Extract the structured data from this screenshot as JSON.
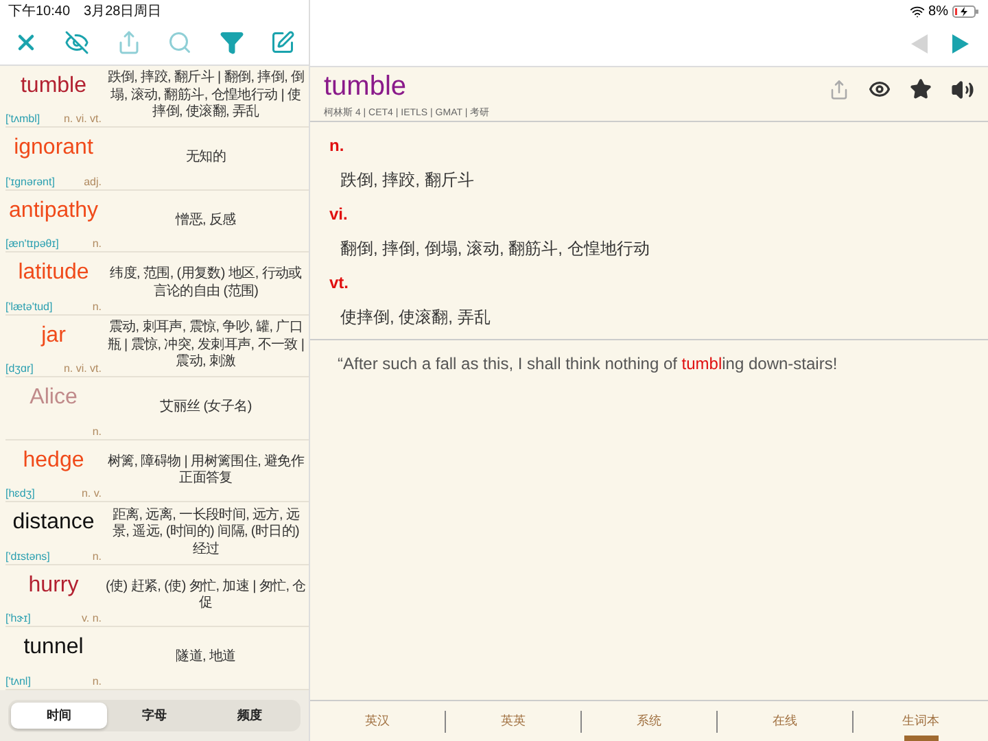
{
  "status_bar": {
    "time": "下午10:40",
    "date": "3月28日周日",
    "battery": "8%"
  },
  "toolbar": {
    "buttons": [
      {
        "kind": "close"
      },
      {
        "kind": "hide"
      },
      {
        "kind": "share"
      },
      {
        "kind": "search"
      },
      {
        "kind": "filter"
      },
      {
        "kind": "edit"
      }
    ]
  },
  "word_list": [
    {
      "word": "tumble",
      "color": "#b22030",
      "phonetic": "['tʌmbl]",
      "pos": "n. vi. vt.",
      "meaning": "跌倒, 摔跤, 翻斤斗 | 翻倒, 摔倒, 倒塌, 滚动, 翻筋斗, 仓惶地行动 | 使摔倒, 使滚翻, 弄乱"
    },
    {
      "word": "ignorant",
      "color": "#f04a1a",
      "phonetic": "['ɪgnərənt]",
      "pos": "adj.",
      "meaning": "无知的"
    },
    {
      "word": "antipathy",
      "color": "#f04a1a",
      "phonetic": "[æn'tɪpəθɪ]",
      "pos": "n.",
      "meaning": "憎恶, 反感"
    },
    {
      "word": "latitude",
      "color": "#f04a1a",
      "phonetic": "['lætə'tud]",
      "pos": "n.",
      "meaning": "纬度, 范围, (用复数) 地区, 行动或言论的自由 (范围)"
    },
    {
      "word": "jar",
      "color": "#f04a1a",
      "phonetic": "[dʒɑr]",
      "pos": "n. vi. vt.",
      "meaning": "震动, 刺耳声, 震惊, 争吵, 罐, 广口瓶 | 震惊, 冲突, 发刺耳声, 不一致 | 震动, 刺激"
    },
    {
      "word": "Alice",
      "color": "#c08a8a",
      "pos": "n.",
      "meaning": "艾丽丝 (女子名)"
    },
    {
      "word": "hedge",
      "color": "#f04a1a",
      "phonetic": "[hɛdʒ]",
      "pos": "n. v.",
      "meaning": "树篱, 障碍物 | 用树篱围住, 避免作正面答复"
    },
    {
      "word": "distance",
      "color": "#111111",
      "phonetic": "['dɪstəns]",
      "pos": "n.",
      "meaning": "距离, 远离, 一长段时间, 远方, 远景, 遥远, (时间的) 间隔, (时日的) 经过"
    },
    {
      "word": "hurry",
      "color": "#b22030",
      "phonetic": "['hɝɪ]",
      "pos": "v. n.",
      "meaning": "(使) 赶紧, (使) 匆忙, 加速 | 匆忙, 仓促"
    },
    {
      "word": "tunnel",
      "color": "#111111",
      "phonetic": "['tʌnl]",
      "pos": "n.",
      "meaning": "隧道, 地道"
    }
  ],
  "sort_tabs": [
    {
      "label": "时间",
      "selected": true
    },
    {
      "label": "字母",
      "selected": false
    },
    {
      "label": "频度",
      "selected": false
    }
  ],
  "nav": {
    "back_disabled": true,
    "forward_disabled": false
  },
  "entry": {
    "word": "tumble",
    "tags": "柯林斯 4 | CET4 | IETLS | GMAT | 考研",
    "senses": [
      {
        "pos": "n.",
        "meaning": "跌倒, 摔跤, 翻斤斗"
      },
      {
        "pos": "vi.",
        "meaning": "翻倒, 摔倒, 倒塌, 滚动, 翻筋斗, 仓惶地行动"
      },
      {
        "pos": "vt.",
        "meaning": "使摔倒, 使滚翻, 弄乱"
      }
    ],
    "example": {
      "before": "“After such a fall as this, I shall think nothing of ",
      "highlight": "tumbl",
      "after": "ing down-stairs!"
    }
  },
  "bottom_tabs": [
    {
      "label": "英汉",
      "selected": false
    },
    {
      "label": "英英",
      "selected": false
    },
    {
      "label": "系统",
      "selected": false
    },
    {
      "label": "在线",
      "selected": false
    },
    {
      "label": "生词本",
      "selected": true
    }
  ]
}
